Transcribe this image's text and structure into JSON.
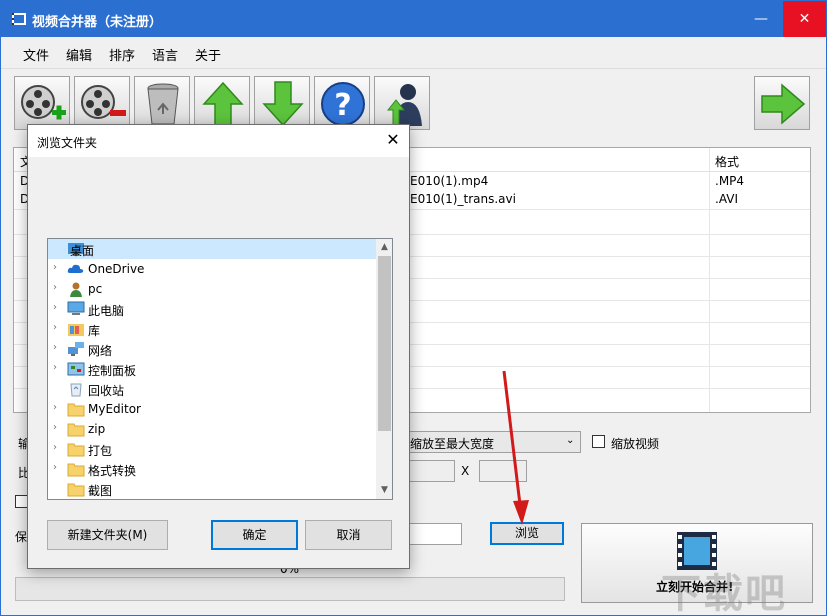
{
  "window": {
    "title": "视频合并器（未注册）",
    "min_glyph": "—",
    "max_glyph": "☐",
    "close_glyph": "✕"
  },
  "menu": [
    "文件",
    "编辑",
    "排序",
    "语言",
    "关于"
  ],
  "toolbar": [
    {
      "icon": "film-reel-add-icon"
    },
    {
      "icon": "film-reel-remove-icon"
    },
    {
      "icon": "trash-bin-icon"
    },
    {
      "icon": "arrow-up-icon"
    },
    {
      "icon": "arrow-down-icon"
    },
    {
      "icon": "help-icon"
    },
    {
      "icon": "user-upload-icon"
    },
    {
      "icon": "arrow-right-icon"
    }
  ],
  "filelist": {
    "header_left": "文",
    "header_format": "格式",
    "rows": [
      {
        "prefix": "D",
        "name": "E010(1).mp4",
        "format": ".MP4"
      },
      {
        "prefix": "D",
        "name": "E010(1)_trans.avi",
        "format": ".AVI"
      }
    ]
  },
  "output": {
    "label_prefix": "输",
    "ratio_prefix": "比",
    "save_prefix": "保",
    "scale_option": "缩放至最大宽度",
    "scale_video_label": "缩放视频",
    "x_label": "X",
    "browse_label": "浏览",
    "progress_text": "0%",
    "merge_label": "立刻开始合并!"
  },
  "dialog": {
    "title": "浏览文件夹",
    "close_glyph": "✕",
    "tree": [
      {
        "label": "桌面",
        "icon": "desktop-icon",
        "chevron": "",
        "selected": true
      },
      {
        "label": "OneDrive",
        "icon": "cloud-icon",
        "chevron": "›"
      },
      {
        "label": "pc",
        "icon": "user-icon",
        "chevron": "›"
      },
      {
        "label": "此电脑",
        "icon": "computer-icon",
        "chevron": "›"
      },
      {
        "label": "库",
        "icon": "library-icon",
        "chevron": "›"
      },
      {
        "label": "网络",
        "icon": "network-icon",
        "chevron": "›"
      },
      {
        "label": "控制面板",
        "icon": "control-panel-icon",
        "chevron": "›"
      },
      {
        "label": "回收站",
        "icon": "recycle-bin-icon",
        "chevron": ""
      },
      {
        "label": "MyEditor",
        "icon": "folder-icon",
        "chevron": "›"
      },
      {
        "label": "zip",
        "icon": "folder-icon",
        "chevron": "›"
      },
      {
        "label": "打包",
        "icon": "folder-icon",
        "chevron": "›"
      },
      {
        "label": "格式转换",
        "icon": "folder-icon",
        "chevron": "›"
      },
      {
        "label": "截图",
        "icon": "folder-icon",
        "chevron": ""
      }
    ],
    "scroll_up_glyph": "▲",
    "scroll_down_glyph": "▼",
    "new_folder_label": "新建文件夹(M)",
    "ok_label": "确定",
    "cancel_label": "取消"
  },
  "watermark": "下载吧",
  "colors": {
    "titlebar": "#2b6fd1",
    "close": "#e81123",
    "selection": "#cce8ff",
    "arrow": "#d21a1a"
  }
}
